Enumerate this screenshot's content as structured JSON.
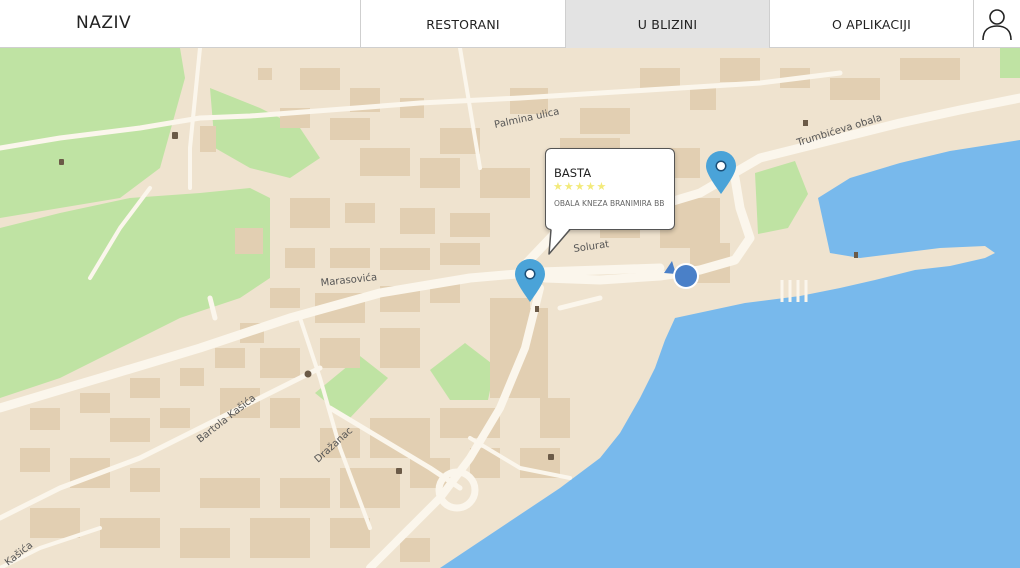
{
  "header": {
    "brand": "NAZIV",
    "tabs": [
      {
        "label": "RESTORANI",
        "active": false
      },
      {
        "label": "U BLIZINI",
        "active": true
      },
      {
        "label": "O APLIKACIJI",
        "active": false
      }
    ],
    "user_icon": "user-icon"
  },
  "map": {
    "streets": {
      "palmina": "Palmina ulica",
      "trumbiceva": "Trumbićeva obala",
      "solurat": "Solurat",
      "marasovica": "Marasovića",
      "bartola": "Bartola Kašića",
      "drazanac": "Dražanac",
      "kasica": "Kašića"
    },
    "colors": {
      "land": "#efe3cf",
      "buildings": "#e2cfb2",
      "parks": "#bfe3a3",
      "water": "#78b9ec",
      "pin": "#4aa3d8",
      "location": "#4a80c8"
    },
    "pin_icon": "map-pin-icon",
    "location_icon": "current-location-icon"
  },
  "callout": {
    "name": "BASTA",
    "stars": "★★★★★",
    "rating": 5,
    "address": "OBALA KNEZA BRANIMIRA BB"
  }
}
